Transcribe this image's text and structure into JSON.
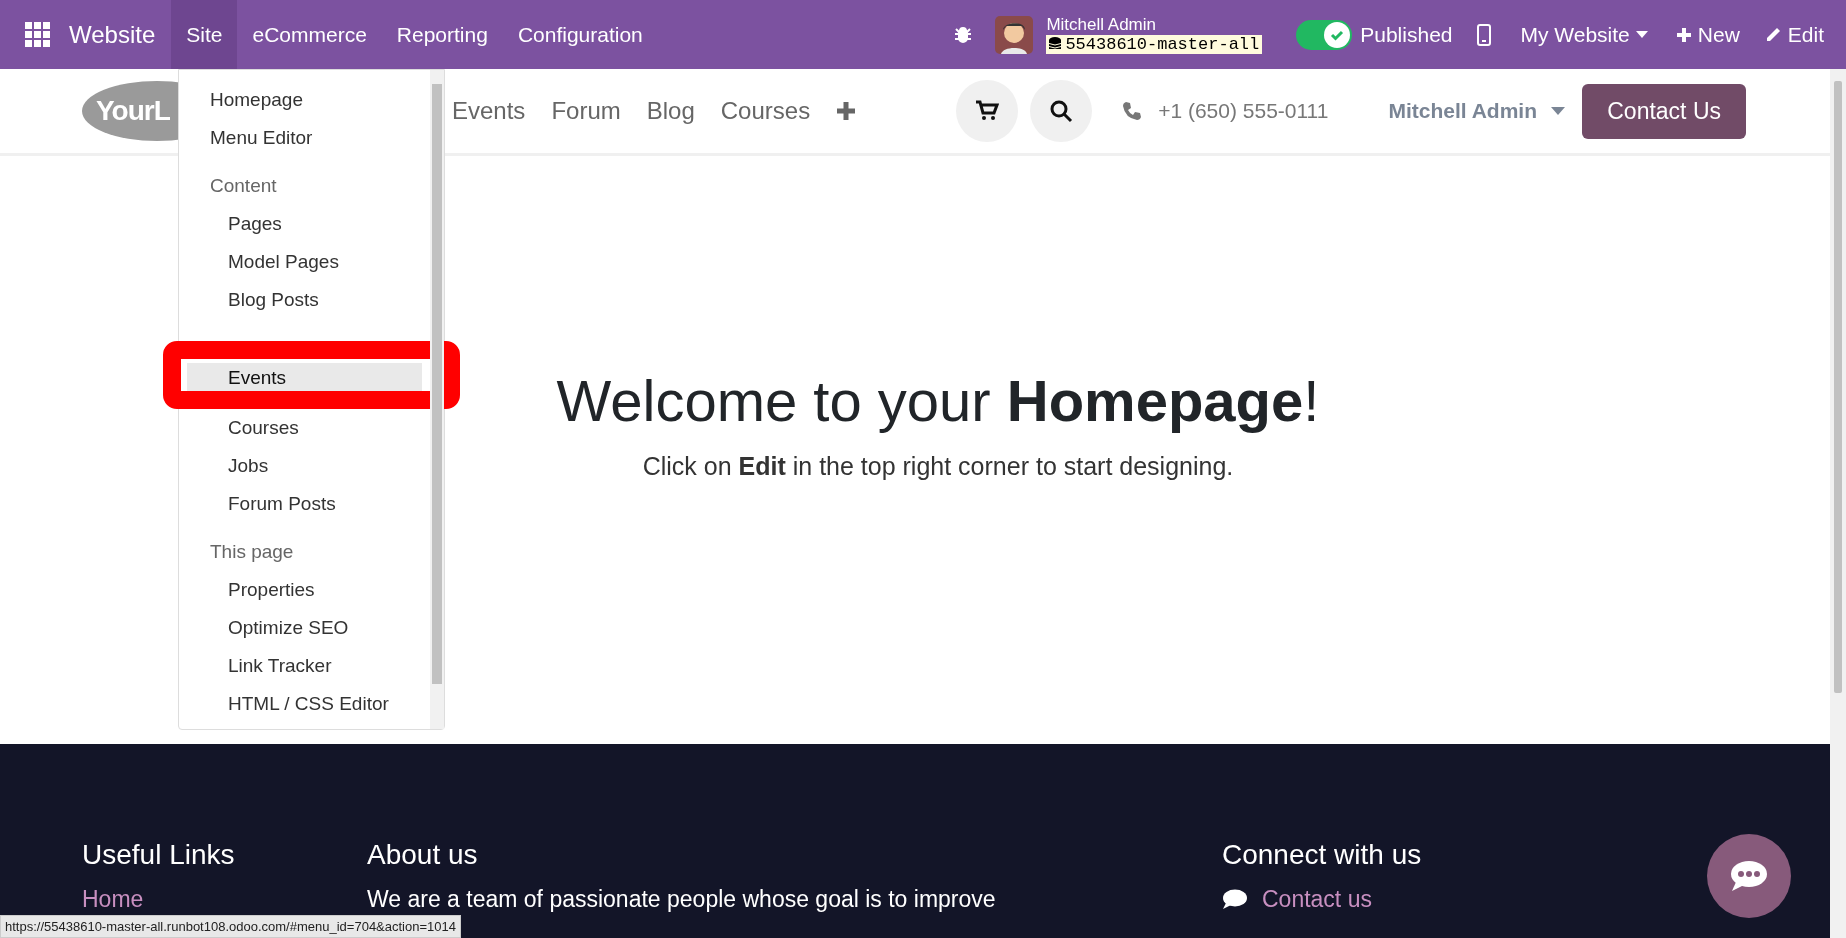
{
  "topbar": {
    "app_name": "Website",
    "menus": [
      {
        "label": "Site",
        "selected": true
      },
      {
        "label": "eCommerce",
        "selected": false
      },
      {
        "label": "Reporting",
        "selected": false
      },
      {
        "label": "Configuration",
        "selected": false
      }
    ],
    "user": "Mitchell Admin",
    "database": "55438610-master-all",
    "published": {
      "label": "Published",
      "on": true
    },
    "website": "My Website",
    "new": "New",
    "edit": "Edit"
  },
  "header": {
    "logo": "YourL",
    "nav": [
      "Events",
      "Forum",
      "Blog",
      "Courses"
    ],
    "phone": "+1 (650) 555-0111",
    "user": "Mitchell Admin",
    "contact": "Contact Us"
  },
  "dropdown": {
    "items": [
      {
        "label": "Homepage",
        "selected": false
      },
      {
        "label": "Menu Editor",
        "selected": false
      }
    ],
    "sections": [
      {
        "header": "Content",
        "items": [
          {
            "label": "Pages",
            "selected": false
          },
          {
            "label": "Model Pages",
            "selected": false
          },
          {
            "label": "Blog Posts",
            "selected": false
          },
          {
            "label": "Events",
            "selected": true,
            "annotated": true
          },
          {
            "label": "Courses",
            "selected": false
          },
          {
            "label": "Jobs",
            "selected": false
          },
          {
            "label": "Forum Posts",
            "selected": false
          }
        ]
      },
      {
        "header": "This page",
        "items": [
          {
            "label": "Properties",
            "selected": false
          },
          {
            "label": "Optimize SEO",
            "selected": false
          },
          {
            "label": "Link Tracker",
            "selected": false
          },
          {
            "label": "HTML / CSS Editor",
            "selected": false
          }
        ]
      }
    ]
  },
  "hero": {
    "title": "Welcome to your **Homepage**!",
    "subtitle": "Click on **Edit** in the top right corner to start designing."
  },
  "footer": {
    "columns": [
      {
        "heading": "Useful Links",
        "link": "Home"
      },
      {
        "heading": "About us",
        "text": "We are a team of passionate people whose goal is to improve"
      },
      {
        "heading": "Connect with us",
        "link": "Contact us"
      }
    ]
  },
  "status_url": "https://55438610-master-all.runbot108.odoo.com/#menu_id=704&action=1014"
}
